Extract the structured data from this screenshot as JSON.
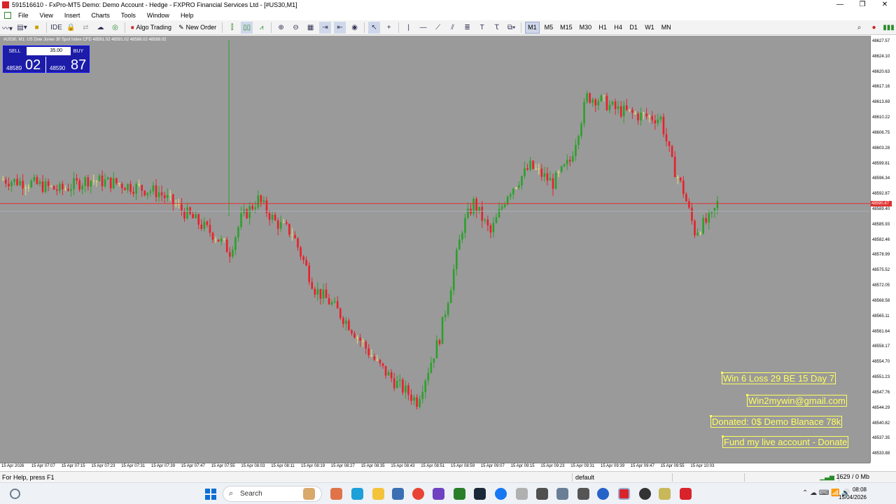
{
  "window": {
    "title": "591516610 - FxPro-MT5 Demo: Demo Account - Hedge - FXPRO Financial Services Ltd - [#US30,M1]",
    "controls": [
      "—",
      "❐",
      "✕"
    ]
  },
  "menu": [
    "File",
    "View",
    "Insert",
    "Charts",
    "Tools",
    "Window",
    "Help"
  ],
  "toolbar": {
    "algo_trading": "Algo Trading",
    "new_order": "New Order",
    "timeframes": [
      "M1",
      "M5",
      "M15",
      "M30",
      "H1",
      "H4",
      "D1",
      "W1",
      "MN"
    ],
    "active_timeframe": "M1"
  },
  "chart": {
    "symbol_line": "#US30, M1:  US Dow Jones 30 Spot Index CFD  48591.02 48591.02 48588.02 48589.02",
    "current_price_label": "48590.87",
    "one_click": {
      "sell_label": "SELL",
      "buy_label": "BUY",
      "lot": "35.00",
      "sell_small": "48589",
      "sell_big": "02",
      "buy_small": "48590",
      "buy_big": "87"
    },
    "y_ticks": [
      "48627.57",
      "48624.10",
      "48620.63",
      "48617.16",
      "48613.69",
      "48610.22",
      "48606.75",
      "48603.28",
      "48599.81",
      "48596.34",
      "48592.87",
      "48589.40",
      "48585.93",
      "48582.46",
      "48578.99",
      "48575.52",
      "48572.05",
      "48568.58",
      "48565.11",
      "48561.64",
      "48558.17",
      "48554.70",
      "48551.23",
      "48547.76",
      "48544.29",
      "48540.82",
      "48537.35",
      "48533.88"
    ],
    "x_ticks": [
      "15 Apr 2026",
      "15 Apr 07:07",
      "15 Apr 07:15",
      "15 Apr 07:23",
      "15 Apr 07:31",
      "15 Apr 07:39",
      "15 Apr 07:47",
      "15 Apr 07:55",
      "15 Apr 08:03",
      "15 Apr 08:11",
      "15 Apr 08:19",
      "15 Apr 08:27",
      "15 Apr 08:35",
      "15 Apr 08:43",
      "15 Apr 08:51",
      "15 Apr 08:59",
      "15 Apr 09:07",
      "15 Apr 09:15",
      "15 Apr 09:23",
      "15 Apr 09:31",
      "15 Apr 09:39",
      "15 Apr 09:47",
      "15 Apr 09:55",
      "15 Apr 10:03"
    ],
    "annotations": [
      "Win 6  Loss 29  BE 15  Day 7",
      "Win2mywin@gmail.com",
      "Donated: 0$  Demo Blanace 78k",
      "Fund my live account - Donate"
    ],
    "colors": {
      "background": "#9a9a9a",
      "bull": "#2ca02c",
      "bear": "#e8202a",
      "doji": "#e8e070",
      "price_line": "#e03030"
    }
  },
  "status": {
    "help": "For Help, press F1",
    "profile": "default",
    "traffic": "1629 / 0 Mb"
  },
  "taskbar": {
    "search_placeholder": "Search",
    "time": "08:08",
    "date": "15/04/2026"
  },
  "chart_data": {
    "type": "candlestick",
    "price_unit": "index points",
    "y_range": [
      48532,
      48629
    ],
    "current_price": 48590.87,
    "shape_keyframes": [
      [
        0,
        48596.3
      ],
      [
        10,
        48595.5
      ],
      [
        20,
        48593.9
      ],
      [
        30,
        48596.3
      ],
      [
        40,
        48595.5
      ],
      [
        55,
        48593.4
      ],
      [
        62,
        48589.9
      ],
      [
        75,
        48583.5
      ],
      [
        80,
        48580.0
      ],
      [
        84,
        48587.4
      ],
      [
        90,
        48591.8
      ],
      [
        96,
        48586.7
      ],
      [
        102,
        48584.2
      ],
      [
        110,
        48571.5
      ],
      [
        116,
        48568.0
      ],
      [
        122,
        48563.4
      ],
      [
        132,
        48554.5
      ],
      [
        138,
        48550.5
      ],
      [
        146,
        48546.0
      ],
      [
        154,
        48560.5
      ],
      [
        158,
        48572.5
      ],
      [
        162,
        48585.4
      ],
      [
        166,
        48591.0
      ],
      [
        172,
        48584.1
      ],
      [
        178,
        48593.3
      ],
      [
        186,
        48599.3
      ],
      [
        194,
        48595.5
      ],
      [
        200,
        48600.5
      ],
      [
        206,
        48615.1
      ],
      [
        210,
        48614.6
      ],
      [
        216,
        48612.3
      ],
      [
        224,
        48610.9
      ],
      [
        232,
        48610.2
      ],
      [
        236,
        48600.0
      ],
      [
        240,
        48593.7
      ],
      [
        244,
        48584.5
      ],
      [
        250,
        48587.7
      ],
      [
        252,
        48590.9
      ]
    ]
  }
}
